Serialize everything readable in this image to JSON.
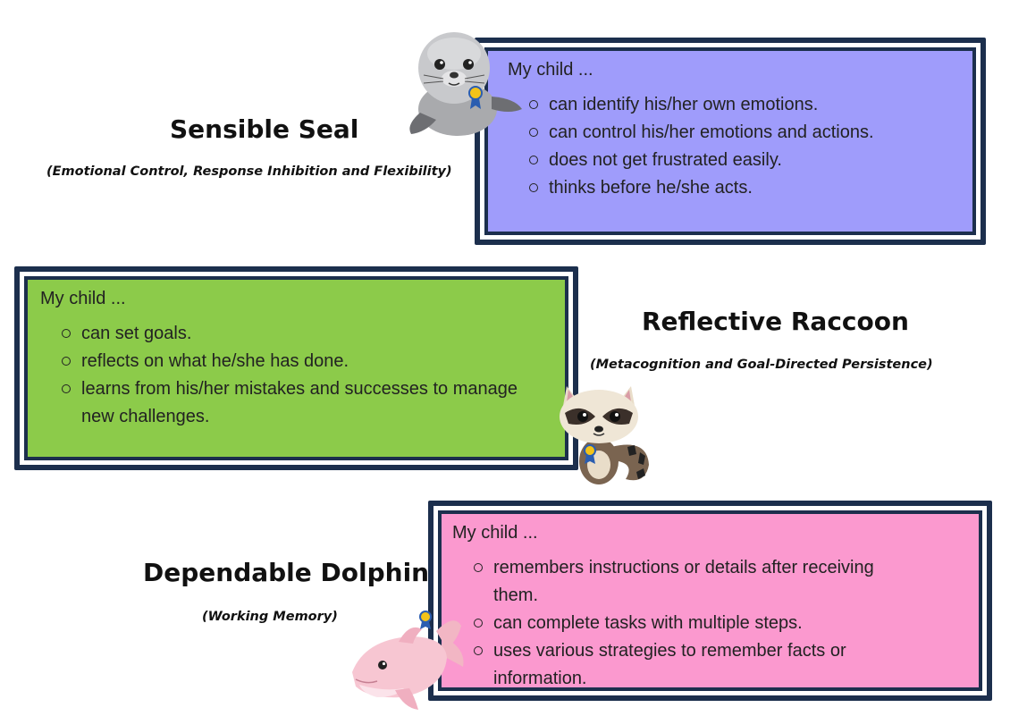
{
  "sections": [
    {
      "title": "Sensible Seal",
      "subtitle": "(Emotional Control, Response Inhibition and Flexibility)",
      "lead": "My child ...",
      "items": [
        "can identify his/her own emotions.",
        "can control his/her emotions and actions.",
        "does not get frustrated easily.",
        "thinks before he/she acts."
      ],
      "panel_color": "#9f9cfb",
      "mascot_icon": "seal-icon"
    },
    {
      "title": "Reflective Raccoon",
      "subtitle": "(Metacognition and Goal-Directed Persistence)",
      "lead": "My child ...",
      "items": [
        "can set goals.",
        "reflects on what he/she has done.",
        "learns from his/her mistakes and successes to manage new challenges."
      ],
      "panel_color": "#8ccb4a",
      "mascot_icon": "raccoon-icon"
    },
    {
      "title": "Dependable Dolphin",
      "subtitle": "(Working Memory)",
      "lead": "My child ...",
      "items": [
        "remembers instructions or details after receiving them.",
        "can complete tasks with multiple steps.",
        "uses various strategies to remember facts or information."
      ],
      "panel_color": "#fb99cf",
      "mascot_icon": "dolphin-icon"
    }
  ],
  "frame_color": "#1c2f4d"
}
